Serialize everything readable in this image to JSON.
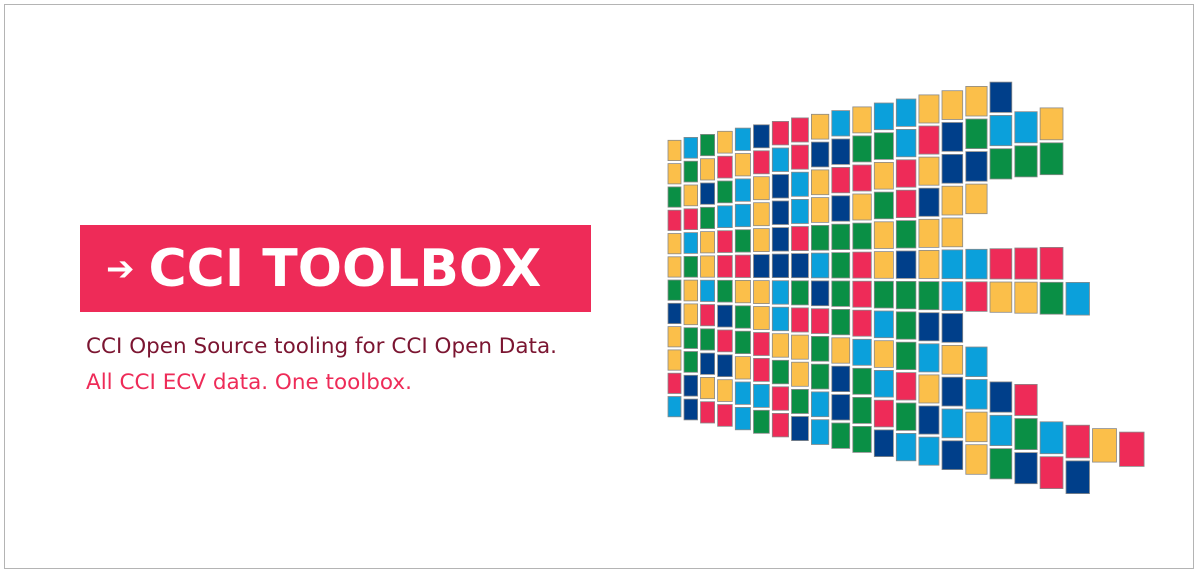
{
  "logo": {
    "arrow_icon": "right-arrow-icon",
    "title": "CCI TOOLBOX",
    "background_color": "#ee2b58"
  },
  "tagline": {
    "line1": "CCI Open Source tooling for CCI Open Data.",
    "line1_color": "#7b1531",
    "line2": "All CCI ECV data. One toolbox.",
    "line2_color": "#ee2b58"
  },
  "mosaic": {
    "palette": [
      "#0a8f45",
      "#ee2b58",
      "#fbbf4a",
      "#0ba0db",
      "#003f8a"
    ]
  }
}
